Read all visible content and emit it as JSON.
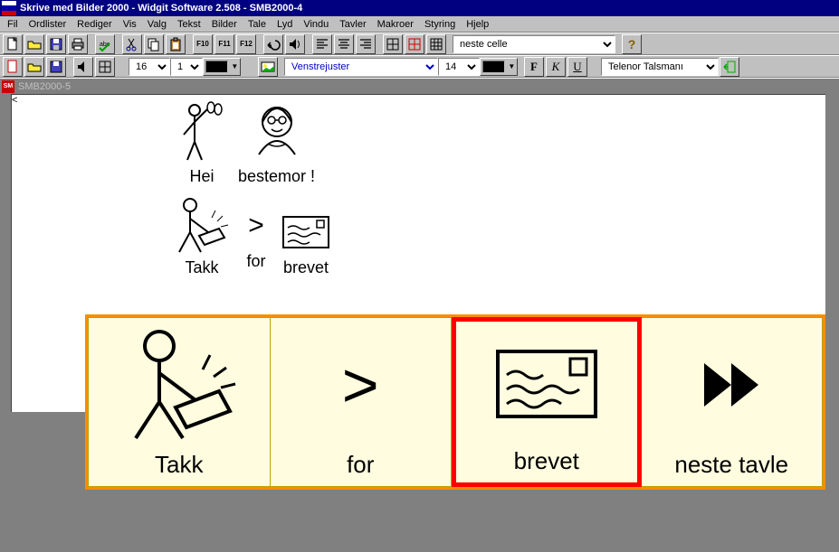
{
  "window": {
    "title": "Skrive med Bilder 2000 - Widgit Software 2.508 - SMB2000-4"
  },
  "menu": {
    "fil": "Fil",
    "ordlister": "Ordlister",
    "rediger": "Rediger",
    "vis": "Vis",
    "valg": "Valg",
    "tekst": "Tekst",
    "bilder": "Bilder",
    "tale": "Tale",
    "lyd": "Lyd",
    "vindu": "Vindu",
    "tavler": "Tavler",
    "makroer": "Makroer",
    "styring": "Styring",
    "hjelp": "Hjelp"
  },
  "toolbar1": {
    "f10": "F10",
    "f11": "F11",
    "f12": "F12",
    "combo": "neste celle",
    "help": "?"
  },
  "toolbar2": {
    "font_size": "16",
    "second_num": "1",
    "third_num": "14",
    "align_label": "Venstrejuster",
    "F": "F",
    "K": "K",
    "U": "U",
    "voice": "Telenor Talsmanı"
  },
  "doc": {
    "tab": "SMB2000-5",
    "row1": [
      {
        "word": "Hei"
      },
      {
        "word": "bestemor !"
      }
    ],
    "row2": [
      {
        "word": "Takk"
      },
      {
        "word": "for"
      },
      {
        "word": "brevet"
      }
    ]
  },
  "board": {
    "cells": [
      {
        "caption": "Takk",
        "selected": false
      },
      {
        "caption": "for",
        "selected": false
      },
      {
        "caption": "brevet",
        "selected": true
      },
      {
        "caption": "neste tavle",
        "selected": false
      }
    ]
  }
}
